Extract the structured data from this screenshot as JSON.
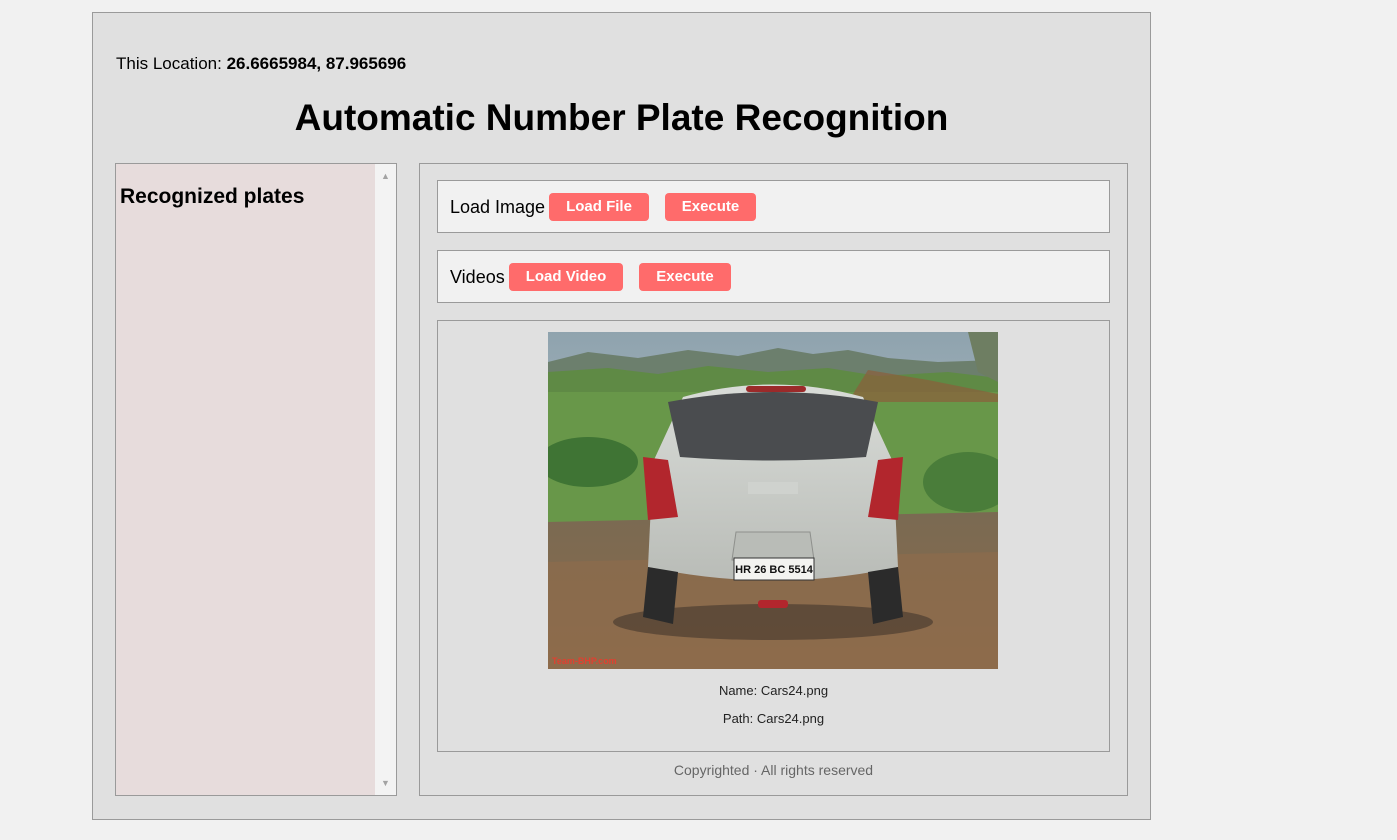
{
  "location": {
    "label": "This Location:",
    "coords": "26.6665984, 87.965696"
  },
  "title": "Automatic Number Plate Recognition",
  "sidebar": {
    "heading": "Recognized plates"
  },
  "image_row": {
    "label": "Load Image",
    "load_label": "Load File",
    "execute_label": "Execute"
  },
  "video_row": {
    "label": "Videos",
    "load_label": "Load Video",
    "execute_label": "Execute"
  },
  "preview": {
    "plate_text": "HR 26 BC 5514",
    "watermark": "Team-BHP.com",
    "name_line": "Name: Cars24.png",
    "path_line": "Path: Cars24.png"
  },
  "footer": {
    "copyright": "Copyrighted · All rights reserved"
  },
  "colors": {
    "button": "#ff6b6b",
    "sidebar_bg": "#e7dcdc",
    "panel_bg": "#e0e0e0",
    "row_bg": "#f1f1f1"
  }
}
